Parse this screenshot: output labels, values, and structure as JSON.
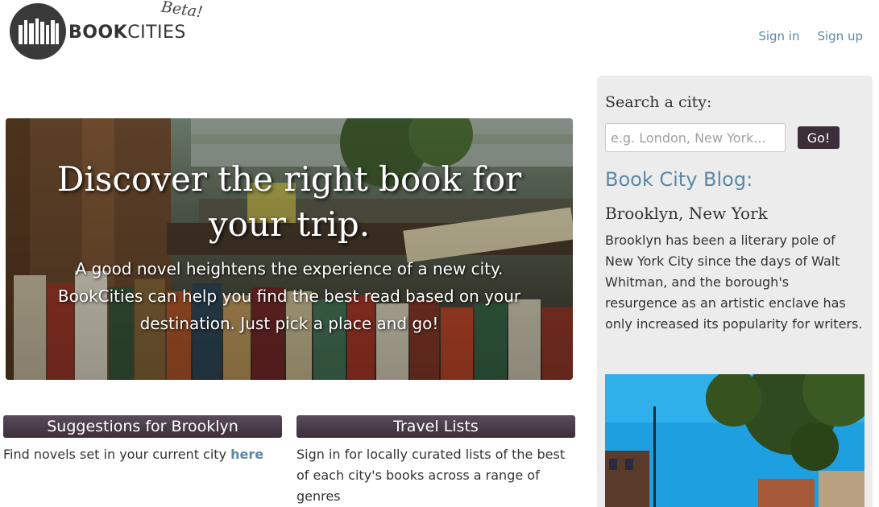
{
  "header": {
    "logo": {
      "brand_bold": "BOOK",
      "brand_light": "CITIES",
      "badge": "Beta!"
    },
    "nav": [
      {
        "label": "Sign in"
      },
      {
        "label": "Sign up"
      }
    ]
  },
  "hero": {
    "title": "Discover the right book for your trip.",
    "subtitle": "A good novel heightens the experience of a new city. BookCities can help you find the best read based on your destination. Just pick a place and go!"
  },
  "suggestions": {
    "heading": "Suggestions for Brooklyn",
    "text": "Find novels set in your current city",
    "link": "here"
  },
  "travel_lists": {
    "heading": "Travel Lists",
    "text": "Sign in for locally curated lists of the best of each city's books across a range of genres"
  },
  "sidebar": {
    "search_label": "Search a city:",
    "search_placeholder": "e.g. London, New York...",
    "go_label": "Go!",
    "blog_heading": "Book City Blog:",
    "post_title": "Brooklyn, New York",
    "post_text": "Brooklyn has been a literary pole of New York City since the days of Walt Whitman, and the borough's resurgence as an artistic enclave has only increased its popularity for writers."
  },
  "colors": {
    "accent": "#5b88a5",
    "button": "#3b2e3b",
    "sidebar_bg": "#ececec"
  }
}
